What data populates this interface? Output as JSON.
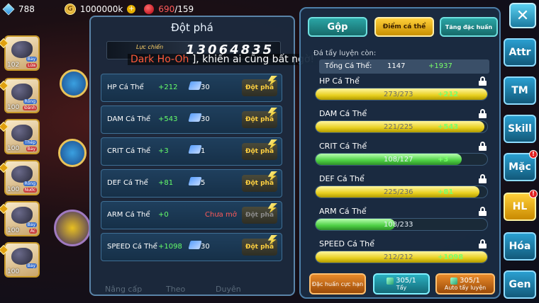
{
  "resources": {
    "gems": "788",
    "gold": "1000000k",
    "stamina_current": "690",
    "stamina_max": "/159"
  },
  "roster": [
    {
      "level": "102",
      "types": [
        "Bay",
        "Lửa"
      ]
    },
    {
      "level": "100",
      "types": [
        "Rồng",
        "Đánh"
      ]
    },
    {
      "level": "100",
      "types": [
        "Thép",
        "Bay"
      ]
    },
    {
      "level": "100",
      "types": [
        "Rồng",
        "Nước"
      ]
    },
    {
      "level": "100",
      "types": [
        "Bay",
        "Ác"
      ]
    },
    {
      "level": "100",
      "types": [
        "Bay",
        ""
      ]
    }
  ],
  "breakthrough": {
    "title": "Đột phá",
    "power_label": "Lực chiến",
    "power_value": "13064835",
    "overlay_name": "Dark Ho-Oh",
    "overlay_rest": "], khiến ai cũng bất ngờ!",
    "rows": [
      {
        "label": "HP Cá Thể",
        "value": "+212",
        "tickets": "30",
        "button": "Đột phá",
        "locked": false
      },
      {
        "label": "DAM Cá Thể",
        "value": "+543",
        "tickets": "30",
        "button": "Đột phá",
        "locked": false
      },
      {
        "label": "CRIT Cá Thể",
        "value": "+3",
        "tickets": "1",
        "button": "Đột phá",
        "locked": false
      },
      {
        "label": "DEF Cá Thể",
        "value": "+81",
        "tickets": "5",
        "button": "Đột phá",
        "locked": false
      },
      {
        "label": "ARM Cá Thể",
        "value": "+0",
        "status": "Chưa mở",
        "button": "Đột phá",
        "locked": true
      },
      {
        "label": "SPEED Cá Thể",
        "value": "+1098",
        "tickets": "30",
        "button": "Đột phá",
        "locked": false
      }
    ],
    "bottom_tabs": [
      "Nâng cấp",
      "Theo",
      "Duyên"
    ]
  },
  "iv_panel": {
    "tabs": {
      "merge": "Gộp",
      "iv_points": "Điểm cá thể",
      "special_training": "Tăng đặc huấn"
    },
    "remaining_label": "Đá tẩy luyện còn:",
    "total_label": "Tổng Cá Thể:",
    "total_value": "1147",
    "total_bonus": "+1937",
    "stats": [
      {
        "name": "HP Cá Thể",
        "current": 273,
        "max": 273,
        "text": "273/273",
        "bonus": "+212",
        "color": "yellow",
        "lock": true
      },
      {
        "name": "DAM Cá Thể",
        "current": 221,
        "max": 225,
        "text": "221/225",
        "bonus": "+543",
        "color": "yellow",
        "lock": true
      },
      {
        "name": "CRIT Cá Thể",
        "current": 108,
        "max": 127,
        "text": "108/127",
        "bonus": "+3",
        "color": "green",
        "lock": true
      },
      {
        "name": "DEF Cá Thể",
        "current": 225,
        "max": 236,
        "text": "225/236",
        "bonus": "+81",
        "color": "yellow",
        "lock": true
      },
      {
        "name": "ARM Cá Thể",
        "current": 108,
        "max": 233,
        "text": "108/233",
        "bonus": "",
        "color": "green",
        "lock": true
      },
      {
        "name": "SPEED Cá Thể",
        "current": 212,
        "max": 212,
        "text": "212/212",
        "bonus": "+1098",
        "color": "yellow",
        "lock": true
      }
    ],
    "bottom": {
      "special_label": "Đặc huấn cực hạn",
      "wash_count": "305/1",
      "wash_label": "Tẩy",
      "auto_count": "305/1",
      "auto_label": "Auto tẩy luyện"
    }
  },
  "side_nav": [
    {
      "label": "Attr",
      "badge": false
    },
    {
      "label": "TM",
      "badge": false
    },
    {
      "label": "Skill",
      "badge": false
    },
    {
      "label": "Mặc",
      "badge": true
    },
    {
      "label": "HL",
      "badge": true
    },
    {
      "label": "Hóa",
      "badge": false
    },
    {
      "label": "Gen",
      "badge": false
    }
  ],
  "close_label": "✕"
}
